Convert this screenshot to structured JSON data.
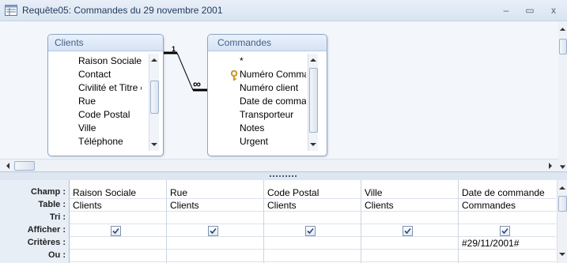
{
  "window": {
    "title": "Requête05: Commandes du 29 novembre 2001",
    "minimize_glyph": "–",
    "maximize_glyph": "▭",
    "close_glyph": "x"
  },
  "relationship": {
    "left_cardinality": "1",
    "right_cardinality": "∞"
  },
  "tables": {
    "clients": {
      "title": "Clients",
      "fields": [
        "Raison Sociale",
        "Contact",
        "Civilité et Titre c",
        "Rue",
        "Code Postal",
        "Ville",
        "Téléphone"
      ]
    },
    "commandes": {
      "title": "Commandes",
      "fields": [
        "*",
        "Numéro Comma",
        "Numéro client",
        "Date de comma",
        "Transporteur",
        "Notes",
        "Urgent"
      ]
    }
  },
  "grid": {
    "row_labels": [
      "Champ :",
      "Table :",
      "Tri :",
      "Afficher :",
      "Critères :",
      "Ou :"
    ],
    "columns": [
      {
        "champ": "Raison Sociale",
        "table": "Clients",
        "tri": "",
        "afficher": true,
        "criteres": "",
        "ou": ""
      },
      {
        "champ": "Rue",
        "table": "Clients",
        "tri": "",
        "afficher": true,
        "criteres": "",
        "ou": ""
      },
      {
        "champ": "Code Postal",
        "table": "Clients",
        "tri": "",
        "afficher": true,
        "criteres": "",
        "ou": ""
      },
      {
        "champ": "Ville",
        "table": "Clients",
        "tri": "",
        "afficher": true,
        "criteres": "",
        "ou": ""
      },
      {
        "champ": "Date de commande",
        "table": "Commandes",
        "tri": "",
        "afficher": true,
        "criteres": "#29/11/2001#",
        "ou": ""
      }
    ]
  },
  "colors": {
    "accent": "#41618c",
    "header_bg": "#d6e3f4",
    "key_icon": "#c99a1e"
  },
  "icons": [
    "query-window-icon",
    "primary-key-icon",
    "checkmark-icon",
    "scroll-up-arrow-icon",
    "scroll-down-arrow-icon",
    "scroll-left-arrow-icon",
    "scroll-right-arrow-icon"
  ]
}
